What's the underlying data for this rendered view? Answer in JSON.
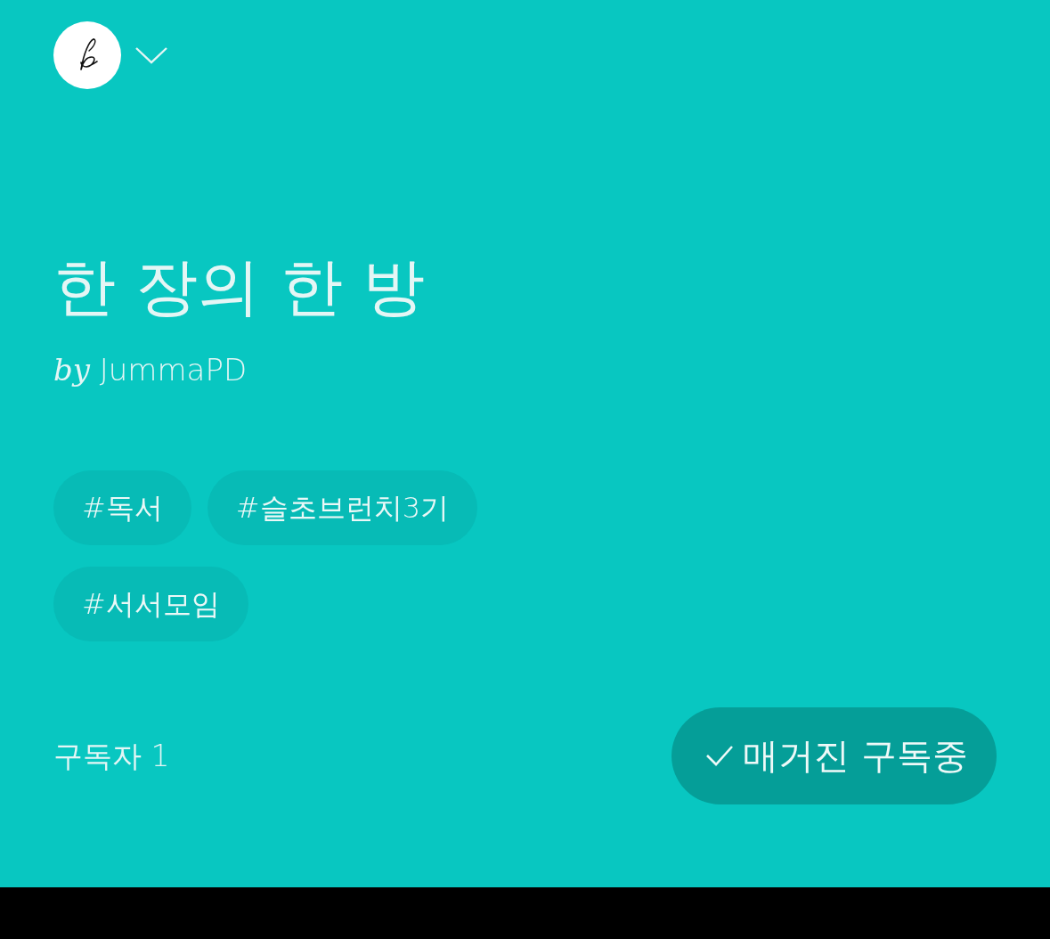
{
  "magazine": {
    "title": "한 장의 한 방",
    "author": "*by* JummaPD",
    "tags": [
      "#독서",
      "#슬초브런치3기",
      "#서서모임"
    ],
    "subscribers": "구독자 1",
    "subscribe_button": {
      "label": "매거진 구독중",
      "subscribed": true
    }
  }
}
